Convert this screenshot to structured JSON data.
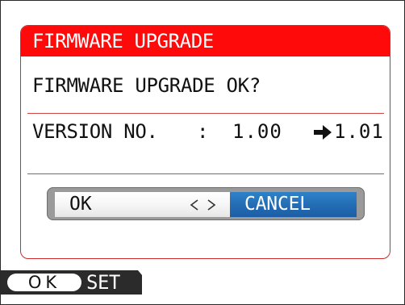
{
  "dialog": {
    "title": "FIRMWARE UPGRADE",
    "question": "FIRMWARE UPGRADE OK?",
    "version": {
      "label": "VERSION NO.",
      "separator": ":",
      "current": "1.00",
      "new": "1.01"
    },
    "buttons": {
      "ok_label": "OK",
      "cancel_label": "CANCEL",
      "selected": "CANCEL"
    }
  },
  "footer": {
    "ok_icon_label": "OK",
    "set_label": "SET"
  },
  "colors": {
    "title_bar": "#ff0a0a",
    "dialog_border": "#cf2b2b",
    "cancel_selected": "#236cb4",
    "button_strip": "#9a9a9a",
    "footer_bar": "#2b2b2b"
  },
  "icons": {
    "version_arrow": "arrow-right-icon",
    "nav_left": "chevron-left-icon",
    "nav_right": "chevron-right-icon",
    "ok_button_glyph": "ok-oval-icon"
  }
}
